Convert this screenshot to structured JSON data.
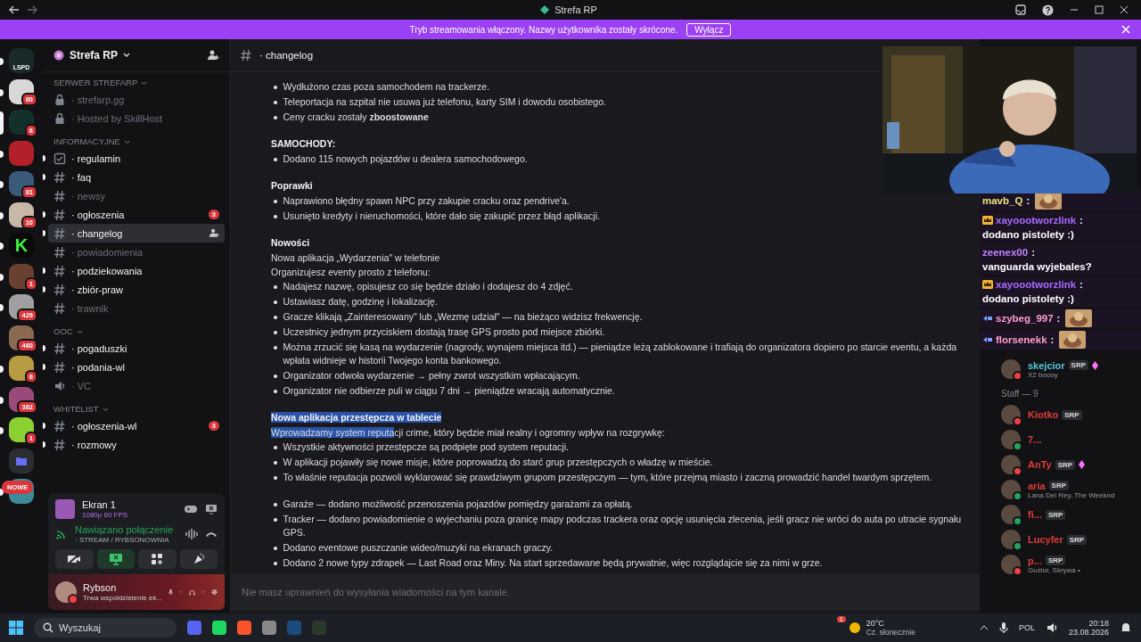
{
  "window": {
    "title": "Strefa RP"
  },
  "banner": {
    "text": "Tryb streamowania włączony. Nazwy użytkownika zostały skrócone.",
    "button": "Wyłącz"
  },
  "servers": [
    {
      "kind": "server",
      "label": "LSPD",
      "unread": true,
      "selected": false
    },
    {
      "kind": "server",
      "badge": "60",
      "unread": true,
      "selected": false
    },
    {
      "kind": "server",
      "badge": "6",
      "unread": false,
      "selected": true
    },
    {
      "kind": "server",
      "unread": true,
      "selected": false
    },
    {
      "kind": "server",
      "badge": "81",
      "unread": true,
      "selected": false
    },
    {
      "kind": "server",
      "badge": "10",
      "unread": true,
      "selected": false
    },
    {
      "kind": "server",
      "label": "K",
      "unread": true,
      "selected": false
    },
    {
      "kind": "server",
      "badge": "1",
      "unread": true,
      "selected": false
    },
    {
      "kind": "server",
      "badge": "429",
      "unread": true,
      "selected": false
    },
    {
      "kind": "server",
      "badge": "460",
      "unread": false,
      "selected": false
    },
    {
      "kind": "server",
      "badge": "6",
      "unread": true,
      "selected": false
    },
    {
      "kind": "server",
      "badge": "362",
      "unread": true,
      "selected": false
    },
    {
      "kind": "server",
      "badge": "1",
      "unread": true,
      "selected": false
    },
    {
      "kind": "folder",
      "unread": false,
      "selected": false
    },
    {
      "kind": "server",
      "pill": "NOWE",
      "unread": true,
      "selected": false
    }
  ],
  "sidebar": {
    "server_name": "Strefa RP",
    "categories": [
      {
        "name": "SERWER STREFARP",
        "channels": [
          {
            "name": "· strefarp.gg",
            "kind": "locked",
            "unread": false,
            "selected": false
          },
          {
            "name": "· Hosted by SkillHost",
            "kind": "locked",
            "unread": false,
            "selected": false
          }
        ]
      },
      {
        "name": "INFORMACYJNE",
        "channels": [
          {
            "name": "· regulamin",
            "kind": "rules",
            "unread": true,
            "selected": false
          },
          {
            "name": "· faq",
            "kind": "text",
            "unread": true,
            "selected": false
          },
          {
            "name": "· newsy",
            "kind": "text",
            "unread": false,
            "selected": false
          },
          {
            "name": "· ogłoszenia",
            "kind": "text",
            "unread": true,
            "selected": false,
            "badge": "3"
          },
          {
            "name": "· changelog",
            "kind": "text",
            "unread": true,
            "selected": true
          },
          {
            "name": "· powiadomienia",
            "kind": "text",
            "unread": false,
            "selected": false
          },
          {
            "name": "· podziekowania",
            "kind": "text",
            "unread": true,
            "selected": false
          },
          {
            "name": "· zbiór-praw",
            "kind": "text",
            "unread": true,
            "selected": false
          },
          {
            "name": "· trawnik",
            "kind": "text",
            "unread": false,
            "selected": false
          }
        ]
      },
      {
        "name": "OOC",
        "channels": [
          {
            "name": "· pogaduszki",
            "kind": "text",
            "unread": true,
            "selected": false
          },
          {
            "name": "· podania-wl",
            "kind": "text",
            "unread": true,
            "selected": false
          },
          {
            "name": "· VC",
            "kind": "voice",
            "unread": false,
            "selected": false
          }
        ]
      },
      {
        "name": "WHITELIST",
        "channels": [
          {
            "name": "· ogłoszenia-wl",
            "kind": "text",
            "unread": true,
            "selected": false,
            "badge": "3"
          },
          {
            "name": "· rozmowy",
            "kind": "text",
            "unread": true,
            "selected": false
          }
        ]
      }
    ]
  },
  "stream": {
    "title": "Ekran 1",
    "quality": "1080p 60 FPS"
  },
  "voice": {
    "status": "Nawiązano połączenie",
    "channel": "· STREAM / RYBSONOWNIA",
    "buttons": [
      {
        "kind": "camera",
        "selected": false
      },
      {
        "kind": "screen",
        "selected": true
      },
      {
        "kind": "activities",
        "selected": false
      },
      {
        "kind": "soundboard",
        "selected": false
      }
    ]
  },
  "user": {
    "name": "Rybson",
    "status": "Trwa współdzielenie ek..."
  },
  "channel": {
    "name": "· changelog"
  },
  "sections": [
    {
      "bullets": [
        "Wydłużono czas poza samochodem na trackerze.",
        "Teleportacja na szpital nie usuwa już telefonu, karty SIM i dowodu osobistego.",
        "Ceny cracku zostały **zboostowane**"
      ]
    },
    {
      "heading": "SAMOCHODY:",
      "heading_selected": false,
      "bullets": [
        "Dodano 115 nowych pojazdów u dealera samochodowego."
      ]
    },
    {
      "heading": "Poprawki",
      "heading_selected": false,
      "bullets": [
        "Naprawiono błędny spawn NPC przy zakupie cracku oraz pendrive'a.",
        "Usunięto kredyty i nieruchomości, które dało się zakupić przez błąd aplikacji."
      ]
    },
    {
      "heading": "Nowości",
      "heading_selected": false,
      "lines": [
        [
          {
            "text": "Nowa aplikacja „Wydarzenia\" w telefonie",
            "selected": false
          }
        ],
        [
          {
            "text": "Organizujesz eventy prosto z telefonu:",
            "selected": false
          }
        ]
      ],
      "bullets": [
        "Nadajesz nazwę, opisujesz co się będzie działo i dodajesz do 4 zdjęć.",
        "Ustawiasz datę, godzinę i lokalizację.",
        "Gracze klikają „Zainteresowany\" lub „Wezmę udział\" — na bieżąco widzisz frekwencję.",
        "Uczestnicy jednym przyciskiem dostają trasę GPS prosto pod miejsce zbiórki.",
        "Można zrzucić się kasą na wydarzenie (nagrody, wynajem miejsca itd.) — pieniądze leżą zablokowane i trafiają do organizatora dopiero po starcie eventu, a każda wpłata widnieje w historii Twojego konta bankowego.",
        "Organizator odwoła wydarzenie → pełny zwrot wszystkim wpłacającym.",
        "Organizator nie odbierze puli w ciągu 7 dni → pieniądze wracają automatycznie."
      ]
    },
    {
      "heading": "Nowa aplikacja przestępcza w tablecie",
      "heading_selected": true,
      "lines": [
        [
          {
            "text": "Wprowadzamy system reputa",
            "selected": true
          },
          {
            "text": "cji crime, który będzie miał realny i ogromny wpływ na rozgrywkę:",
            "selected": false
          }
        ]
      ],
      "bullets": [
        "Wszystkie aktywności przestępcze są podpięte pod system reputacji.",
        "W aplikacji pojawiły się nowe misje, które poprowadzą do starć grup przestępczych o władzę w mieście.",
        "To właśnie reputacja pozwoli wyklarować się prawdziwym grupom przestępczym — tym, które przejmą miasto i zaczną prowadzić handel twardym sprzętem."
      ]
    },
    {
      "bullets": [
        "Garaże — dodano możliwość przenoszenia pojazdów pomiędzy garażami za opłatą.",
        "Tracker — dodano powiadomienie o wyjechaniu poza granicę mapy podczas trackera oraz opcję usunięcia zlecenia, jeśli gracz nie wróci do auta po utracie sygnału GPS.",
        "Dodano eventowe puszczanie wideo/muzyki na ekranach graczy.",
        "Dodano 2 nowe typy zdrapek — Last Road oraz Miny. Na start sprzedawane będą prywatnie, więc rozglądajcie się za nimi w grze."
      ]
    }
  ],
  "composer": {
    "placeholder": "Nie masz uprawnień do wysyłania wiadomości na tym kanale."
  },
  "chat_overlay": [
    {
      "user": "mavb_Q",
      "separator": ":",
      "color": "#e8e07a",
      "crown": false,
      "subscriber": false,
      "emote": true
    },
    {
      "user": "xayoootworzlink",
      "separator": ":",
      "color": "#a66bff",
      "crown": true,
      "subscriber": false,
      "text": "dodano pistolety :)"
    },
    {
      "user": "zeenex00",
      "separator": ":",
      "color": "#c084fc",
      "crown": false,
      "subscriber": false,
      "text": "vanguarda wyjebales?"
    },
    {
      "user": "xayoootworzlink",
      "separator": ":",
      "color": "#a66bff",
      "crown": true,
      "subscriber": false,
      "text": "dodano pistolety :)"
    },
    {
      "user": "szybeg_997",
      "separator": ":",
      "color": "#ff9ecb",
      "crown": false,
      "subscriber": true,
      "emote": true
    },
    {
      "user": "florsenekk",
      "separator": ":",
      "color": "#ff9ecb",
      "crown": false,
      "subscriber": true,
      "emote": true
    }
  ],
  "members": [
    {
      "kind": "member",
      "name": "skejcior",
      "color": "#56c6d8",
      "tag": "SRP",
      "boost": true,
      "activity": "X2 boooy",
      "dnd": true
    },
    {
      "kind": "header",
      "text": "Staff — 9"
    },
    {
      "kind": "member",
      "name": "Kiotko",
      "color": "#e23b3b",
      "tag": "SRP",
      "boost": false,
      "dnd": true
    },
    {
      "kind": "member",
      "name": "7...",
      "color": "#e23b3b",
      "boost": false,
      "dnd": false
    },
    {
      "kind": "member",
      "name": "AnTy",
      "color": "#e23b3b",
      "tag": "SRP",
      "boost": true,
      "dnd": true
    },
    {
      "kind": "member",
      "name": "aria",
      "color": "#e23b3b",
      "tag": "SRP",
      "boost": false,
      "activity": "Lana Del Rey, The Weeknd",
      "dnd": false
    },
    {
      "kind": "member",
      "name": "fi...",
      "color": "#e23b3b",
      "tag": "SRP",
      "boost": false,
      "dnd": false
    },
    {
      "kind": "member",
      "name": "Lucyfer",
      "color": "#e23b3b",
      "tag": "SRP",
      "boost": false,
      "dnd": false
    },
    {
      "kind": "member",
      "name": "p...",
      "color": "#e23b3b",
      "tag": "SRP",
      "boost": false,
      "activity": "Guzior, Skrywa •",
      "dnd": true
    }
  ],
  "taskbar": {
    "search": {
      "placeholder": "Wyszukaj"
    },
    "weather": {
      "badge": "1",
      "temp": "20°C",
      "text": "Cz. słonecznie"
    },
    "language": "POL",
    "time": "20:18",
    "date": "23.08.2026"
  }
}
